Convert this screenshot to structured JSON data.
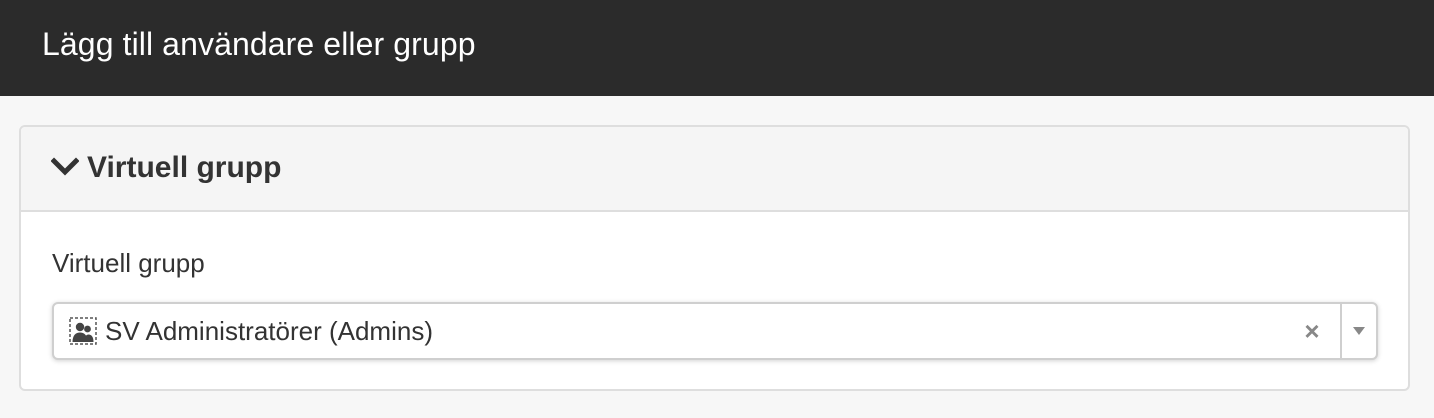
{
  "dialog": {
    "title": "Lägg till användare eller grupp"
  },
  "panel": {
    "heading": "Virtuell grupp",
    "field_label": "Virtuell grupp",
    "selected_value": "SV Administratörer (Admins)",
    "clear_glyph": "×",
    "icons": {
      "heading": "chevron-down-icon",
      "value": "virtual-group-icon",
      "clear": "clear-icon",
      "dropdown": "dropdown-arrow-icon"
    }
  },
  "colors": {
    "header_bg": "#2b2b2b",
    "page_bg": "#f7f7f7",
    "panel_heading_bg": "#f5f5f5",
    "text": "#333333"
  }
}
